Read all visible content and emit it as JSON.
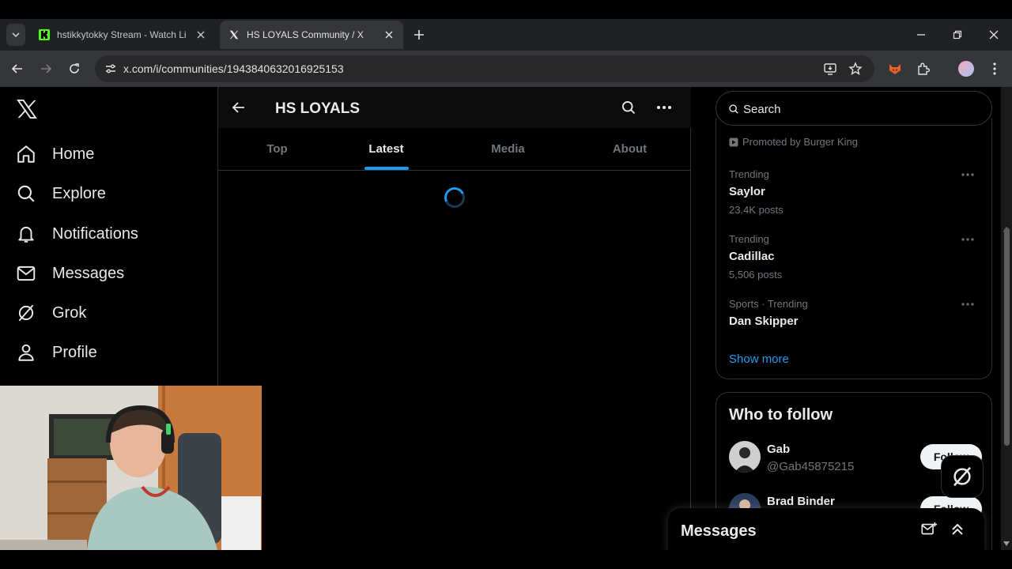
{
  "browser": {
    "tabs": [
      {
        "title": "hstikkytokky Stream - Watch Li",
        "favicon": "kick-icon",
        "active": false
      },
      {
        "title": "HS LOYALS Community / X",
        "favicon": "x-logo-icon",
        "active": true
      }
    ],
    "url": "x.com/i/communities/1943840632016925153"
  },
  "nav": {
    "items": [
      {
        "label": "Home",
        "icon": "home-icon"
      },
      {
        "label": "Explore",
        "icon": "search-icon"
      },
      {
        "label": "Notifications",
        "icon": "bell-icon"
      },
      {
        "label": "Messages",
        "icon": "mail-icon"
      },
      {
        "label": "Grok",
        "icon": "grok-icon"
      },
      {
        "label": "Profile",
        "icon": "person-icon"
      }
    ]
  },
  "community": {
    "title": "HS LOYALS",
    "tabs": [
      {
        "label": "Top",
        "active": false
      },
      {
        "label": "Latest",
        "active": true
      },
      {
        "label": "Media",
        "active": false
      },
      {
        "label": "About",
        "active": false
      }
    ]
  },
  "sidebar": {
    "search_placeholder": "Search",
    "promoted": "Promoted by Burger King",
    "trends": [
      {
        "category": "Trending",
        "name": "Saylor",
        "count": "23.4K posts"
      },
      {
        "category": "Trending",
        "name": "Cadillac",
        "count": "5,506 posts"
      },
      {
        "category": "Sports · Trending",
        "name": "Dan Skipper",
        "count": ""
      }
    ],
    "show_more": "Show more",
    "who_to_follow": {
      "title": "Who to follow",
      "people": [
        {
          "name": "Gab",
          "handle": "@Gab45875215",
          "button": "Follow"
        },
        {
          "name": "Brad Binder",
          "handle": "",
          "button": "Follow"
        }
      ]
    }
  },
  "messages_drawer": {
    "title": "Messages"
  },
  "colors": {
    "accent": "#1d9bf0",
    "background": "#000000",
    "border": "#2f3336",
    "muted": "#71767b"
  }
}
